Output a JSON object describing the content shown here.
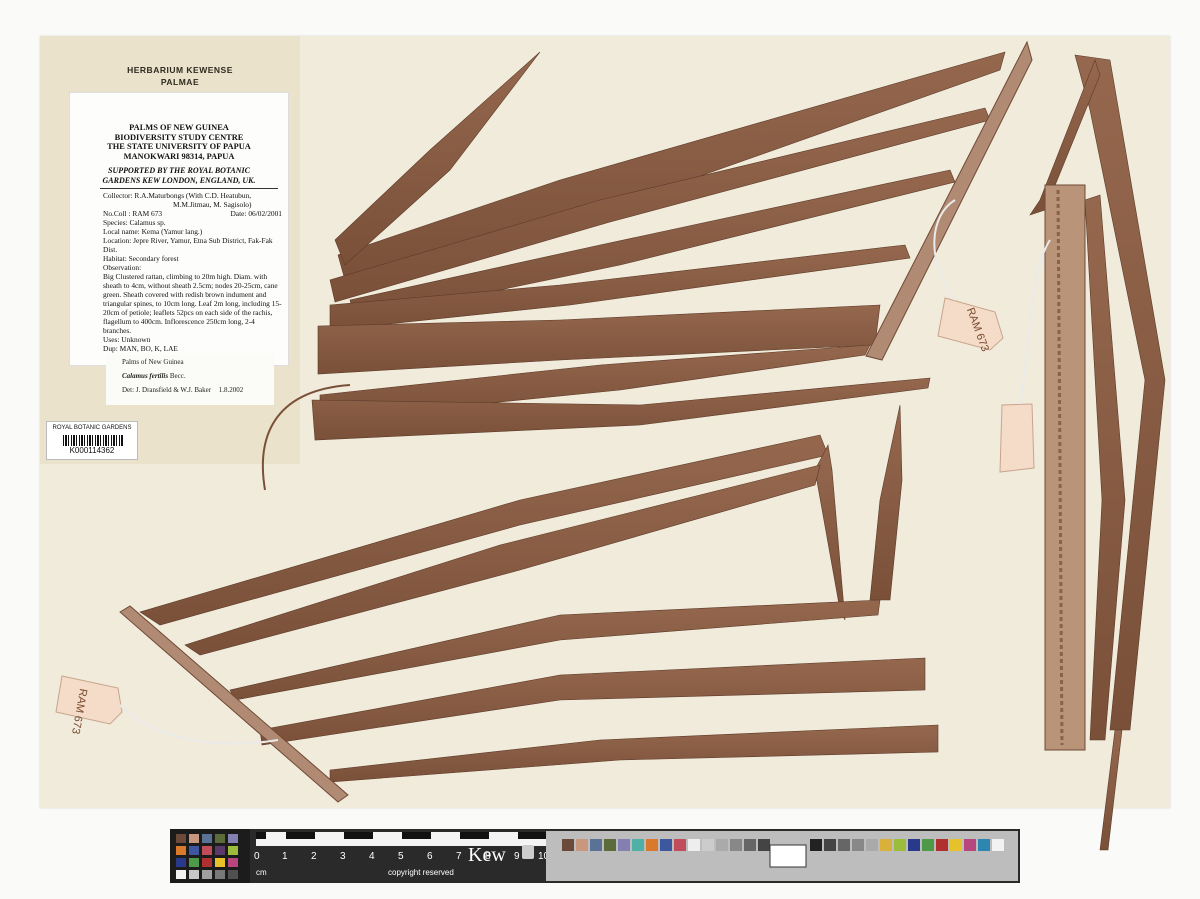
{
  "herbarium": {
    "line1": "HERBARIUM KEWENSE",
    "line2": "PALMAE"
  },
  "main_label": {
    "institution": [
      "PALMS OF NEW GUINEA",
      "BIODIVERSITY STUDY CENTRE",
      "THE STATE UNIVERSITY OF PAPUA",
      "MANOKWARI 98314, PAPUA"
    ],
    "supported": [
      "SUPPORTED BY THE ROYAL BOTANIC",
      "GARDENS KEW LONDON, ENGLAND, UK."
    ],
    "collector": "Collector: R.A.Maturbongs (With C.D. Heatubun,",
    "collector2": "M.M.Jitmau, M. Sagisolo)",
    "no_coll": "No.Coll : RAM 673",
    "date": "Date: 06/02/2001",
    "species": "Species: Calamus sp.",
    "local_name": "Local name: Kema (Yamur lang.)",
    "location": "Location: Jepre River, Yamur, Etna Sub District, Fak-Fak Dist.",
    "habitat": "Habitat: Secondary forest",
    "observation_label": "Observation:",
    "observation": "Big Clustered rattan, climbing to 20m high. Diam. with sheath to 4cm, without sheath 2.5cm; nodes 20-25cm, cane green. Sheath covered with redish brown indument and triangular spines, to 10cm long. Leaf 2m long, including 15-20cm of petiole; leaflets 52pcs on each side of the rachis, flagellum to 400cm. Inflorescence 250cm long, 2-4 branches.",
    "uses": "Uses: Unknown",
    "dup": "Dup: MAN, BO, K, LAE"
  },
  "det_label": {
    "region": "Palms of New Guinea",
    "name": "Calamus fertilis",
    "author": "Becc.",
    "det": "Det: J. Dransfield & W.J. Baker",
    "det_date": "1.8.2002"
  },
  "rbg_label": "ROYAL BOTANIC GARDENS KEW",
  "barcode": "K000114362",
  "tags": {
    "left": "RAM 673",
    "top_right": "RAM 673"
  },
  "scale": {
    "ticks": [
      "0",
      "1",
      "2",
      "3",
      "4",
      "5",
      "6",
      "7",
      "8",
      "9",
      "10"
    ],
    "unit": "cm",
    "copyright": "copyright reserved",
    "logo": "Kew"
  },
  "colors": {
    "paper": "#f1ebdb",
    "leaf": "#8a5e44",
    "leaf_dark": "#6e4632",
    "rachis": "#a8826a"
  }
}
